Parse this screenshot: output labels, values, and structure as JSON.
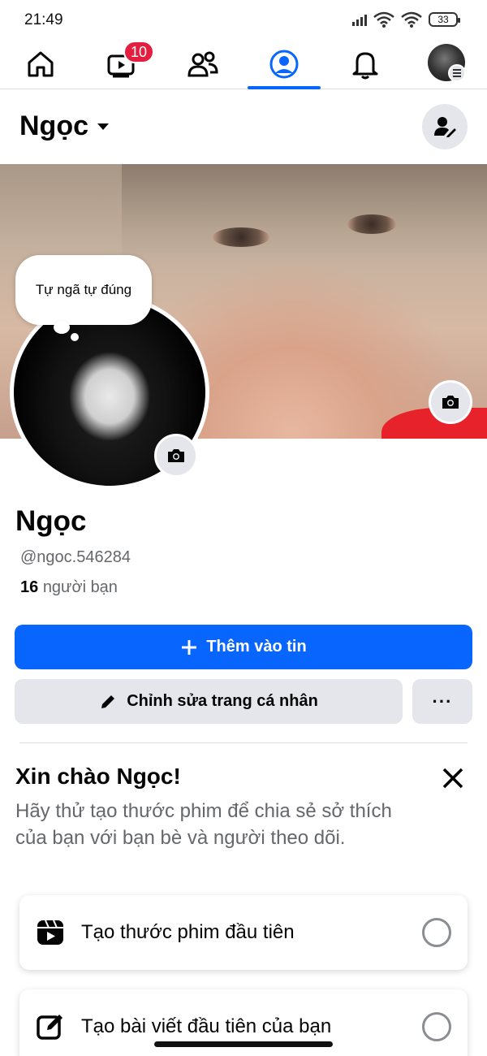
{
  "status_bar": {
    "time": "21:49",
    "battery": "33"
  },
  "nav": {
    "items": [
      {
        "name": "home",
        "icon": "home-icon"
      },
      {
        "name": "video",
        "icon": "video-icon",
        "badge": "10"
      },
      {
        "name": "friends",
        "icon": "friends-icon"
      },
      {
        "name": "profile",
        "icon": "profile-icon",
        "active": true
      },
      {
        "name": "notifications",
        "icon": "bell-icon"
      },
      {
        "name": "menu",
        "icon": "avatar-menu-icon"
      }
    ],
    "accent_color": "#0866ff"
  },
  "header": {
    "name": "Ngọc"
  },
  "note": {
    "text": "Tự ngã tự đúng"
  },
  "profile": {
    "display_name": "Ngọc",
    "username": "@ngoc.546284",
    "friend_count": "16",
    "friend_label": "người bạn"
  },
  "actions": {
    "add_story": "Thêm vào tin",
    "edit_profile": "Chỉnh sửa trang cá nhân",
    "more": "···"
  },
  "greeting": {
    "title": "Xin chào Ngọc!",
    "body": "Hãy thử tạo thước phim để chia sẻ sở thích của bạn với bạn bè và người theo dõi.",
    "tasks": [
      {
        "label": "Tạo thước phim đầu tiên",
        "icon": "reel-icon"
      },
      {
        "label": "Tạo bài viết đầu tiên của bạn",
        "icon": "compose-icon"
      }
    ]
  },
  "colors": {
    "primary": "#0866ff",
    "badge": "#e41e3f",
    "secondary_bg": "#e4e6eb",
    "muted_text": "#65676b"
  }
}
